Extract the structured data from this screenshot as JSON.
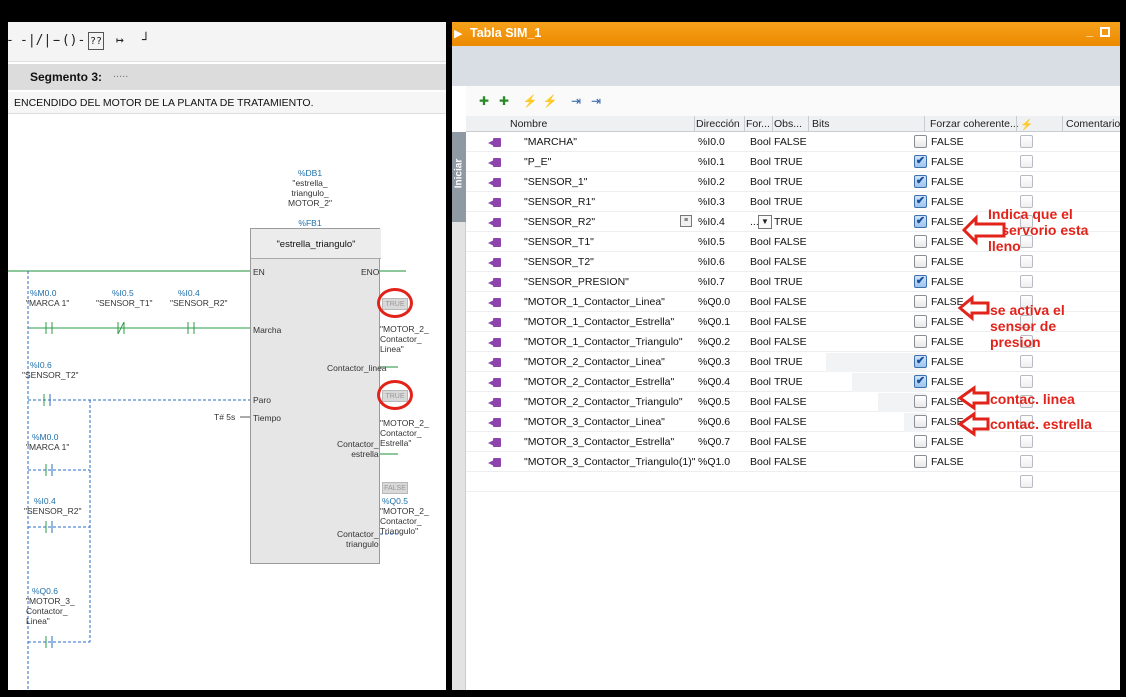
{
  "ladder": {
    "segment_title": "Segmento 3:",
    "segment_dots": ".....",
    "segment_desc": "ENCENDIDO DEL MOTOR DE LA PLANTA DE TRATAMIENTO.",
    "db_addr": "%DB1",
    "db_name": "\"estrella_\ntriangulo_\nMOTOR_2\"",
    "fb_addr": "%FB1",
    "fb_name": "\"estrella_triangulo\"",
    "pin_en": "EN",
    "pin_eno": "ENO",
    "pin_marcha": "Marcha",
    "pin_paro": "Paro",
    "pin_tiempo": "Tiempo",
    "tiempo_value": "T# 5s",
    "out_linea": "Contactor_linea",
    "out_estrella": "Contactor_\nestrella",
    "out_triangulo": "Contactor_\ntriangulo",
    "contact1_addr": "%M0.0",
    "contact1_name": "\"MARCA 1\"",
    "contact2_addr": "%I0.5",
    "contact2_name": "\"SENSOR_T1\"",
    "contact3_addr": "%I0.4",
    "contact3_name": "\"SENSOR_R2\"",
    "paro_addr": "%I0.6",
    "paro_name": "\"SENSOR_T2\"",
    "or1_addr": "%M0.0",
    "or1_name": "\"MARCA 1\"",
    "or2_addr": "%I0.4",
    "or2_name": "\"SENSOR_R2\"",
    "or3_addr": "%Q0.6",
    "or3_name": "\"MOTOR_3_\nContactor_\nLinea\"",
    "out1_state": "TRUE",
    "out1_name": "\"MOTOR_2_\nContactor_\nLinea\"",
    "out2_state": "TRUE",
    "out2_name": "\"MOTOR_2_\nContactor_\nEstrella\"",
    "out3_state": "FALSE",
    "out3_addr": "%Q0.5",
    "out3_name": "\"MOTOR_2_\nContactor_\nTriangulo\""
  },
  "table": {
    "window_title": "Tabla SIM_1",
    "side_tab": "Iniciar",
    "headers": {
      "nombre": "Nombre",
      "direccion": "Dirección",
      "formato": "For...",
      "obs": "Obs...",
      "bits": "Bits",
      "forzar": "Forzar coherente...",
      "comentario": "Comentario"
    },
    "rows": [
      {
        "name": "\"MARCHA\"",
        "addr": "%I0.0",
        "fmt": "Bool",
        "obs": "FALSE",
        "bit": false,
        "force": "FALSE"
      },
      {
        "name": "\"P_E\"",
        "addr": "%I0.1",
        "fmt": "Bool",
        "obs": "TRUE",
        "bit": true,
        "force": "FALSE"
      },
      {
        "name": "\"SENSOR_1\"",
        "addr": "%I0.2",
        "fmt": "Bool",
        "obs": "TRUE",
        "bit": true,
        "force": "FALSE"
      },
      {
        "name": "\"SENSOR_R1\"",
        "addr": "%I0.3",
        "fmt": "Bool",
        "obs": "TRUE",
        "bit": true,
        "force": "FALSE"
      },
      {
        "name": "\"SENSOR_R2\"",
        "addr": "%I0.4",
        "fmt": "...",
        "obs": "TRUE",
        "bit": true,
        "force": "FALSE"
      },
      {
        "name": "\"SENSOR_T1\"",
        "addr": "%I0.5",
        "fmt": "Bool",
        "obs": "FALSE",
        "bit": false,
        "force": "FALSE"
      },
      {
        "name": "\"SENSOR_T2\"",
        "addr": "%I0.6",
        "fmt": "Bool",
        "obs": "FALSE",
        "bit": false,
        "force": "FALSE"
      },
      {
        "name": "\"SENSOR_PRESION\"",
        "addr": "%I0.7",
        "fmt": "Bool",
        "obs": "TRUE",
        "bit": true,
        "force": "FALSE"
      },
      {
        "name": "\"MOTOR_1_Contactor_Linea\"",
        "addr": "%Q0.0",
        "fmt": "Bool",
        "obs": "FALSE",
        "bit": false,
        "force": "FALSE"
      },
      {
        "name": "\"MOTOR_1_Contactor_Estrella\"",
        "addr": "%Q0.1",
        "fmt": "Bool",
        "obs": "FALSE",
        "bit": false,
        "force": "FALSE"
      },
      {
        "name": "\"MOTOR_1_Contactor_Triangulo\"",
        "addr": "%Q0.2",
        "fmt": "Bool",
        "obs": "FALSE",
        "bit": false,
        "force": "FALSE"
      },
      {
        "name": "\"MOTOR_2_Contactor_Linea\"",
        "addr": "%Q0.3",
        "fmt": "Bool",
        "obs": "TRUE",
        "bit": true,
        "force": "FALSE"
      },
      {
        "name": "\"MOTOR_2_Contactor_Estrella\"",
        "addr": "%Q0.4",
        "fmt": "Bool",
        "obs": "TRUE",
        "bit": true,
        "force": "FALSE"
      },
      {
        "name": "\"MOTOR_2_Contactor_Triangulo\"",
        "addr": "%Q0.5",
        "fmt": "Bool",
        "obs": "FALSE",
        "bit": false,
        "force": "FALSE"
      },
      {
        "name": "\"MOTOR_3_Contactor_Linea\"",
        "addr": "%Q0.6",
        "fmt": "Bool",
        "obs": "FALSE",
        "bit": false,
        "force": "FALSE"
      },
      {
        "name": "\"MOTOR_3_Contactor_Estrella\"",
        "addr": "%Q0.7",
        "fmt": "Bool",
        "obs": "FALSE",
        "bit": false,
        "force": "FALSE"
      },
      {
        "name": "\"MOTOR_3_Contactor_Triangulo(1)\"",
        "addr": "%Q1.0",
        "fmt": "Bool",
        "obs": "FALSE",
        "bit": false,
        "force": "FALSE"
      }
    ]
  },
  "annotations": {
    "reservorio": "Indica que el\nreservorio esta\nlleno",
    "presion": "se activa el\nsensor de\npresion",
    "linea": "contac. linea",
    "estrella": "contac. estrella"
  },
  "colors": {
    "title_bar": "#ec8a00",
    "annotation": "#e2231a",
    "tag_icon": "#8e44ad",
    "address_blue": "#1f6fa8"
  }
}
